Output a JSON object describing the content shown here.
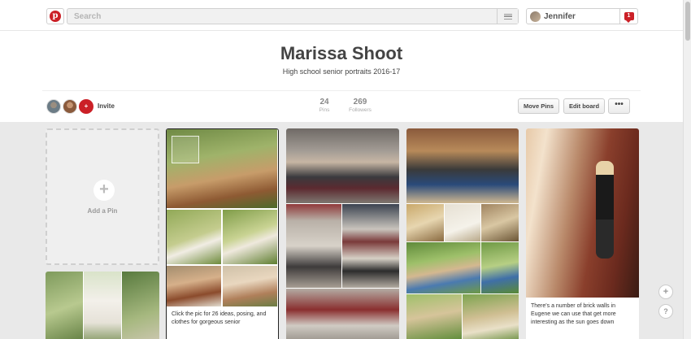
{
  "header": {
    "search_placeholder": "Search",
    "user_name": "Jennifer",
    "notification_count": "1",
    "brand_color": "#cb2027"
  },
  "board": {
    "title": "Marissa Shoot",
    "description": "High school senior portraits 2016-17",
    "invite_label": "Invite",
    "pins_count": "24",
    "pins_label": "Pins",
    "followers_count": "269",
    "followers_label": "Followers",
    "move_pins_label": "Move Pins",
    "edit_board_label": "Edit board",
    "more_label": "•••"
  },
  "grid": {
    "add_pin_label": "Add a Pin",
    "pins": [
      {
        "caption": ""
      },
      {
        "caption": "Click the pic for 26 ideas, posing, and clothes for gorgeous senior"
      },
      {
        "caption": ""
      },
      {
        "caption": ""
      },
      {
        "caption": "There's a number of brick walls in Eugene we can use that get more interesting as the sun goes down"
      }
    ]
  },
  "floating": {
    "add_label": "+",
    "help_label": "?"
  }
}
